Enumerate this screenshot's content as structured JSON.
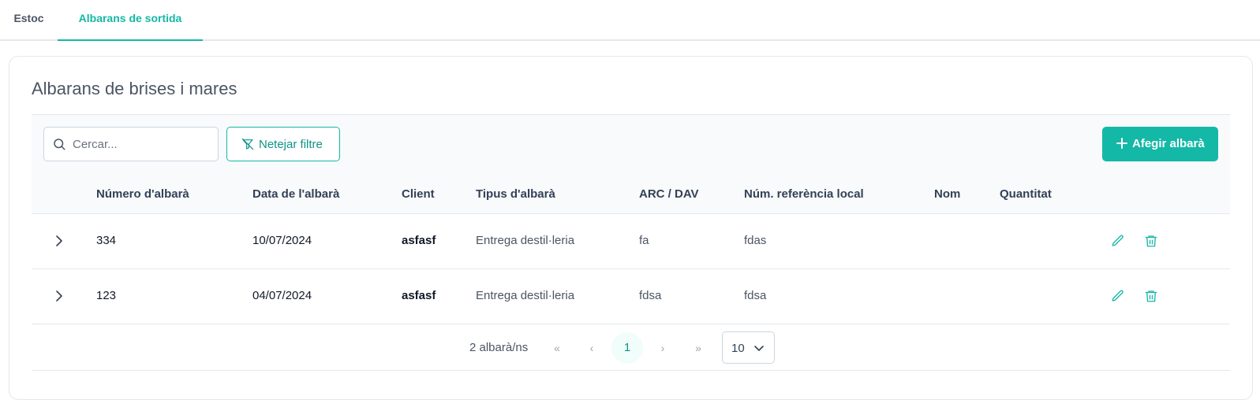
{
  "tabs": [
    {
      "label": "Estoc"
    },
    {
      "label": "Albarans de sortida"
    }
  ],
  "card": {
    "title": "Albarans de brises i mares"
  },
  "toolbar": {
    "search_placeholder": "Cercar...",
    "clear_filter_label": "Netejar filtre",
    "add_label": "Afegir albarà"
  },
  "table": {
    "columns": [
      "Número d'albarà",
      "Data de l'albarà",
      "Client",
      "Tipus d'albarà",
      "ARC / DAV",
      "Núm. referència local",
      "Nom",
      "Quantitat"
    ],
    "rows": [
      {
        "numero": "334",
        "data": "10/07/2024",
        "client": "asfasf",
        "tipus": "Entrega destil·leria",
        "arc": "fa",
        "ref": "fdas",
        "nom": "",
        "quantitat": ""
      },
      {
        "numero": "123",
        "data": "04/07/2024",
        "client": "asfasf",
        "tipus": "Entrega destil·leria",
        "arc": "fdsa",
        "ref": "fdsa",
        "nom": "",
        "quantitat": ""
      }
    ]
  },
  "pagination": {
    "summary": "2 albarà/ns",
    "first": "«",
    "prev": "‹",
    "current_page": "1",
    "next": "›",
    "last": "»",
    "page_size": "10"
  },
  "colors": {
    "accent": "#14b8a6",
    "accent_dark": "#0d9488"
  },
  "icons": [
    "search-icon",
    "filter-clear-icon",
    "plus-icon",
    "chevron-right-icon",
    "pencil-icon",
    "trash-icon",
    "chevron-down-icon"
  ]
}
